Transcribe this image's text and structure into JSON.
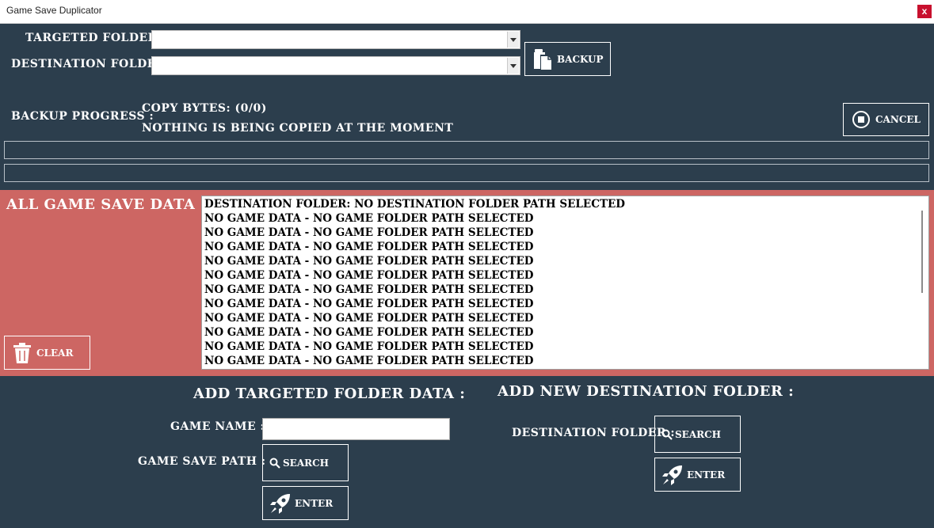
{
  "window": {
    "title": "Game Save Duplicator",
    "close_label": "x"
  },
  "form": {
    "targeted_folder_label": "TARGETED  FOLDER:",
    "targeted_folder_value": "",
    "destination_folder_label": "DESTINATION FOLDER:",
    "destination_folder_value": "",
    "backup_label": "BACKUP"
  },
  "progress": {
    "label": "BACKUP PROGRESS :",
    "copy_bytes": "COPY BYTES: (0/0)",
    "status": "NOTHING IS BEING COPIED AT THE MOMENT",
    "cancel_label": "CANCEL",
    "bar1_fraction": 0,
    "bar2_fraction": 0
  },
  "save_data": {
    "heading": "ALL GAME SAVE DATA :",
    "clear_label": "CLEAR",
    "lines": [
      "DESTINATION FOLDER: NO DESTINATION FOLDER PATH SELECTED",
      "NO GAME DATA - NO GAME FOLDER PATH SELECTED",
      "NO GAME DATA - NO GAME FOLDER PATH SELECTED",
      "NO GAME DATA - NO GAME FOLDER PATH SELECTED",
      "NO GAME DATA - NO GAME FOLDER PATH SELECTED",
      "NO GAME DATA - NO GAME FOLDER PATH SELECTED",
      "NO GAME DATA - NO GAME FOLDER PATH SELECTED",
      "NO GAME DATA - NO GAME FOLDER PATH SELECTED",
      "NO GAME DATA - NO GAME FOLDER PATH SELECTED",
      "NO GAME DATA - NO GAME FOLDER PATH SELECTED",
      "NO GAME DATA - NO GAME FOLDER PATH SELECTED",
      "NO GAME DATA - NO GAME FOLDER PATH SELECTED"
    ]
  },
  "add_target": {
    "heading": "ADD TARGETED FOLDER DATA :",
    "game_name_label": "GAME NAME :",
    "game_name_value": "",
    "save_path_label": "GAME SAVE PATH :",
    "search_label": "SEARCH",
    "enter_label": "ENTER"
  },
  "add_destination": {
    "heading": "ADD NEW DESTINATION FOLDER :",
    "folder_label": "DESTINATION FOLDER :",
    "search_label": "SEARCH",
    "enter_label": "ENTER"
  },
  "colors": {
    "background": "#2c3e4d",
    "accent_panel": "#cd6663",
    "close_button": "#c8102e"
  },
  "icons": {
    "backup": "copy-files-icon",
    "cancel": "stop-circle-icon",
    "clear": "trash-icon",
    "search": "magnifier-icon",
    "enter": "rocket-icon"
  }
}
